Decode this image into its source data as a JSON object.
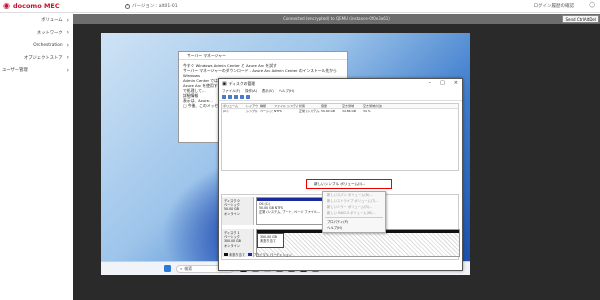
{
  "header": {
    "brand": "docomo MEC",
    "version": "バージョン : alt01-01",
    "login_history": "ログイン履歴の確認",
    "account_initial": "",
    "colors": {
      "brand": "#c8102e"
    }
  },
  "sidebar": {
    "items": [
      {
        "label": "ボリューム"
      },
      {
        "label": "ネットワーク"
      },
      {
        "label": "Orchestration"
      },
      {
        "label": "オブジェクトストア"
      },
      {
        "label": "ユーザー管理"
      }
    ]
  },
  "remote": {
    "status": "Connected (encrypted) to QEMU (instance-0f0e3a61)",
    "cad_button": "Send CtrlAltDel"
  },
  "server_manager": {
    "title": "サーバー マネージャー",
    "line1": "今すぐ Windows Admin Center と Azure Arc を試す",
    "line2": "サーバー マネージャーのダウンロード - Azure Arc Admin Center のインストール先から Windows",
    "line3": "Admin Center では…",
    "line4": "Azure Arc を使用すると…",
    "line5": "で処理して…",
    "line6": "詳細情報",
    "line7": "表示は、Azure…",
    "line8": "□ 今後、このメッセージを表示しない"
  },
  "disk_mgmt": {
    "title": "ディスクの管理",
    "menu": [
      "ファイル(F)",
      "操作(A)",
      "表示(V)",
      "ヘルプ(H)"
    ],
    "columns": [
      "ボリューム",
      "レイアウト",
      "種類",
      "ファイル システム",
      "状態",
      "容量",
      "空き領域",
      "空き領域の割合"
    ],
    "rows": [
      {
        "volume": "(C:)",
        "layout": "シンプル",
        "type": "ベーシック",
        "fs": "NTFS",
        "status": "正常 (システム, ブート…",
        "capacity": "50.00 GB",
        "free": "34.86 GB",
        "pct": "34 %"
      }
    ],
    "new_simple_volume": "新しいシンプル ボリューム(I)...",
    "disks": [
      {
        "name": "ディスク 0",
        "type": "ベーシック",
        "size": "50.00 GB",
        "state": "オンライン",
        "partition": {
          "label": "OS (C:)",
          "size": "50.00 GB NTFS",
          "status": "正常 (システム, ブート, ページ ファイル…"
        }
      },
      {
        "name": "ディスク 1",
        "type": "ベーシック",
        "size": "300.00 GB",
        "state": "オンライン",
        "unallocated": {
          "size": "300.00 GB",
          "label": "未割り当て"
        }
      }
    ],
    "context_menu": {
      "items": [
        {
          "label": "新しいスパン ボリューム(N)...",
          "enabled": false
        },
        {
          "label": "新しいストライプ ボリューム(T)...",
          "enabled": false
        },
        {
          "label": "新しいミラー ボリューム(R)...",
          "enabled": false
        },
        {
          "label": "新しい RAID-5 ボリューム(W)...",
          "enabled": false
        },
        {
          "label": "プロパティ(P)",
          "enabled": true
        },
        {
          "label": "ヘルプ(H)",
          "enabled": true
        }
      ]
    },
    "legend": [
      "未割り当て",
      "プライマリ パーティション"
    ]
  },
  "taskbar": {
    "search_placeholder": "検索",
    "time": "",
    "date": ""
  }
}
